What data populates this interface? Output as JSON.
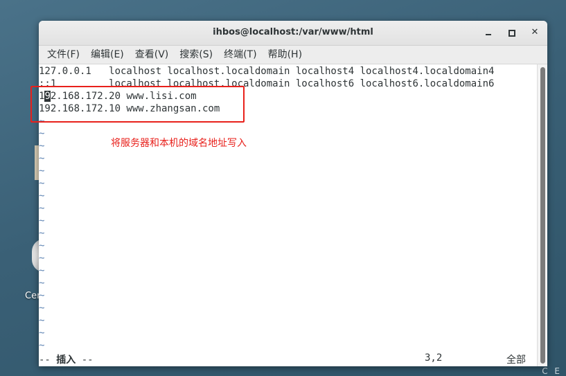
{
  "window": {
    "title": "ihbos@localhost:/var/www/html",
    "controls": {
      "minimize": "minimize",
      "maximize": "maximize",
      "close": "✕"
    }
  },
  "menu": [
    "文件(F)",
    "编辑(E)",
    "查看(V)",
    "搜索(S)",
    "终端(T)",
    "帮助(H)"
  ],
  "editor": {
    "lines": [
      "127.0.0.1   localhost localhost.localdomain localhost4 localhost4.localdomain4",
      "::1         localhost localhost.localdomain localhost6 localhost6.localdomain6",
      "192.168.172.20 www.lisi.com",
      "192.168.172.10 www.zhangsan.com"
    ],
    "cursor_line": 3,
    "cursor_col": 2,
    "empty_marker": "~",
    "empty_lines": 19
  },
  "status": {
    "mode_prefix": "-- ",
    "mode": "插入",
    "mode_suffix": " --",
    "position": "3,2",
    "scroll": "全部"
  },
  "annotation": {
    "text": "将服务器和本机的域名地址写入",
    "color": "#e8201b"
  },
  "desktop": {
    "left_label": "Cer",
    "corner_text": "C E"
  }
}
